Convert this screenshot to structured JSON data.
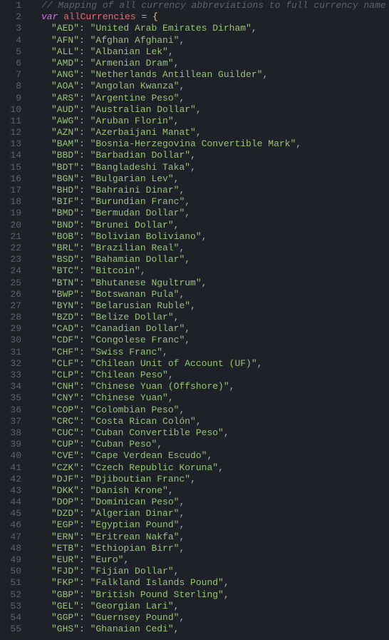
{
  "comment": "// Mapping of all currency abbreviations to full currency name",
  "decl": {
    "kw": "var",
    "name": "allCurrencies",
    "eq": "=",
    "brace": "{"
  },
  "entries": [
    {
      "k": "AED",
      "v": "United Arab Emirates Dirham"
    },
    {
      "k": "AFN",
      "v": "Afghan Afghani"
    },
    {
      "k": "ALL",
      "v": "Albanian Lek"
    },
    {
      "k": "AMD",
      "v": "Armenian Dram"
    },
    {
      "k": "ANG",
      "v": "Netherlands Antillean Guilder"
    },
    {
      "k": "AOA",
      "v": "Angolan Kwanza"
    },
    {
      "k": "ARS",
      "v": "Argentine Peso"
    },
    {
      "k": "AUD",
      "v": "Australian Dollar"
    },
    {
      "k": "AWG",
      "v": "Aruban Florin"
    },
    {
      "k": "AZN",
      "v": "Azerbaijani Manat"
    },
    {
      "k": "BAM",
      "v": "Bosnia-Herzegovina Convertible Mark"
    },
    {
      "k": "BBD",
      "v": "Barbadian Dollar"
    },
    {
      "k": "BDT",
      "v": "Bangladeshi Taka"
    },
    {
      "k": "BGN",
      "v": "Bulgarian Lev"
    },
    {
      "k": "BHD",
      "v": "Bahraini Dinar"
    },
    {
      "k": "BIF",
      "v": "Burundian Franc"
    },
    {
      "k": "BMD",
      "v": "Bermudan Dollar"
    },
    {
      "k": "BND",
      "v": "Brunei Dollar"
    },
    {
      "k": "BOB",
      "v": "Bolivian Boliviano"
    },
    {
      "k": "BRL",
      "v": "Brazilian Real"
    },
    {
      "k": "BSD",
      "v": "Bahamian Dollar"
    },
    {
      "k": "BTC",
      "v": "Bitcoin"
    },
    {
      "k": "BTN",
      "v": "Bhutanese Ngultrum"
    },
    {
      "k": "BWP",
      "v": "Botswanan Pula"
    },
    {
      "k": "BYN",
      "v": "Belarusian Ruble"
    },
    {
      "k": "BZD",
      "v": "Belize Dollar"
    },
    {
      "k": "CAD",
      "v": "Canadian Dollar"
    },
    {
      "k": "CDF",
      "v": "Congolese Franc"
    },
    {
      "k": "CHF",
      "v": "Swiss Franc"
    },
    {
      "k": "CLF",
      "v": "Chilean Unit of Account (UF)"
    },
    {
      "k": "CLP",
      "v": "Chilean Peso"
    },
    {
      "k": "CNH",
      "v": "Chinese Yuan (Offshore)"
    },
    {
      "k": "CNY",
      "v": "Chinese Yuan"
    },
    {
      "k": "COP",
      "v": "Colombian Peso"
    },
    {
      "k": "CRC",
      "v": "Costa Rican Colón"
    },
    {
      "k": "CUC",
      "v": "Cuban Convertible Peso"
    },
    {
      "k": "CUP",
      "v": "Cuban Peso"
    },
    {
      "k": "CVE",
      "v": "Cape Verdean Escudo"
    },
    {
      "k": "CZK",
      "v": "Czech Republic Koruna"
    },
    {
      "k": "DJF",
      "v": "Djiboutian Franc"
    },
    {
      "k": "DKK",
      "v": "Danish Krone"
    },
    {
      "k": "DOP",
      "v": "Dominican Peso"
    },
    {
      "k": "DZD",
      "v": "Algerian Dinar"
    },
    {
      "k": "EGP",
      "v": "Egyptian Pound"
    },
    {
      "k": "ERN",
      "v": "Eritrean Nakfa"
    },
    {
      "k": "ETB",
      "v": "Ethiopian Birr"
    },
    {
      "k": "EUR",
      "v": "Euro"
    },
    {
      "k": "FJD",
      "v": "Fijian Dollar"
    },
    {
      "k": "FKP",
      "v": "Falkland Islands Pound"
    },
    {
      "k": "GBP",
      "v": "British Pound Sterling"
    },
    {
      "k": "GEL",
      "v": "Georgian Lari"
    },
    {
      "k": "GGP",
      "v": "Guernsey Pound"
    },
    {
      "k": "GHS",
      "v": "Ghanaian Cedi"
    }
  ]
}
